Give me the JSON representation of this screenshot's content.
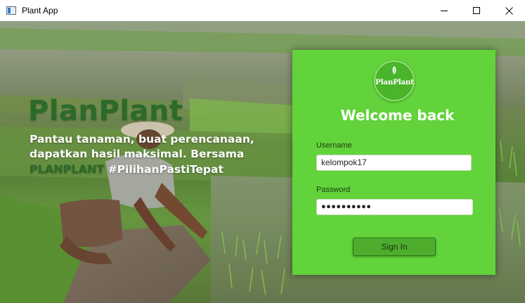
{
  "window": {
    "title": "Plant App",
    "icon": "app-window-icon"
  },
  "hero": {
    "brand": "PlanPlant",
    "tagline_line1": "Pantau tanaman, buat perencanaan,",
    "tagline_line2": "dapatkan hasil maksimal. Bersama",
    "tagline_brand": "PLANPLANT",
    "tagline_hashtag": " #PilihanPastiTepat"
  },
  "login": {
    "logo_text": "PlanPlant",
    "heading": "Welcome back",
    "username_label": "Username",
    "username_value": "kelompok17",
    "password_label": "Password",
    "password_value": "●●●●●●●●●●",
    "signin_label": "Sign In"
  },
  "colors": {
    "panel_green": "#62d33a",
    "brand_dark_green": "#2c6a2a",
    "button_green": "#4ead2d"
  }
}
